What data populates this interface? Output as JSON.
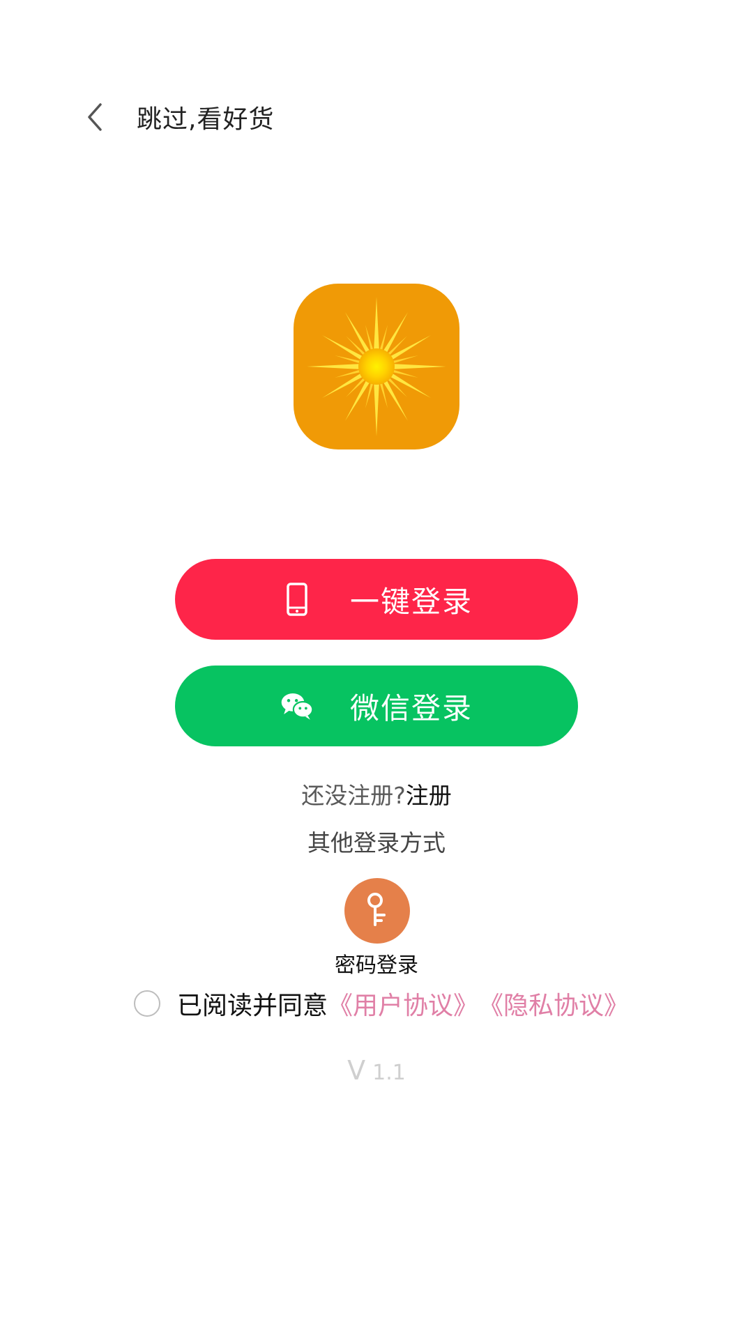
{
  "header": {
    "back_icon": "chevron-left-icon",
    "skip_label": "跳过,看好货"
  },
  "logo": {
    "icon": "sunburst-logo",
    "background": "#f09a06"
  },
  "buttons": {
    "phone_login": {
      "label": "一键登录",
      "icon": "phone-icon",
      "color": "#fe2549"
    },
    "wechat_login": {
      "label": "微信登录",
      "icon": "wechat-icon",
      "color": "#07c361"
    }
  },
  "register": {
    "prompt": "还没注册?",
    "link": "注册"
  },
  "other_methods": {
    "title": "其他登录方式",
    "password_login": {
      "label": "密码登录",
      "icon": "key-icon",
      "color": "#e5804a"
    }
  },
  "agreement": {
    "text": "已阅读并同意",
    "user_agreement": "《用户协议》",
    "privacy_agreement": "《隐私协议》",
    "link_color": "#e07fa6",
    "checked": false
  },
  "version": {
    "prefix": "V",
    "number": "1.1"
  }
}
